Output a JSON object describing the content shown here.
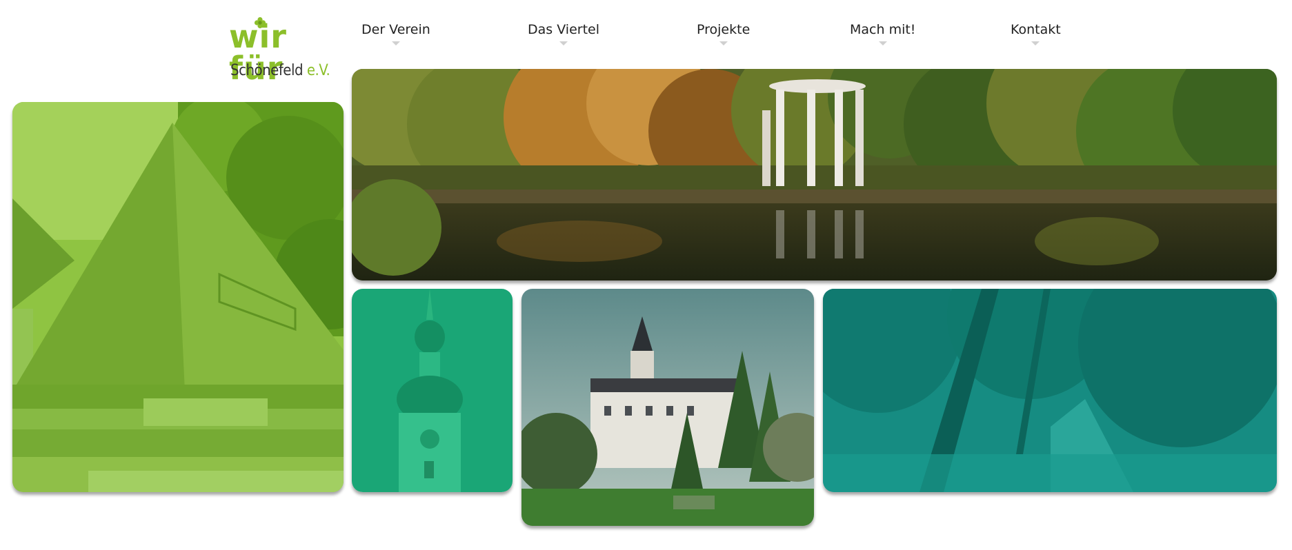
{
  "logo": {
    "line1": "wir für",
    "line2": "Schönefeld",
    "suffix": "e.V.",
    "colors": {
      "green": "#8cbf2a",
      "dark": "#333333"
    }
  },
  "nav": {
    "items": [
      {
        "label": "Der Verein"
      },
      {
        "label": "Das Viertel"
      },
      {
        "label": "Projekte"
      },
      {
        "label": "Mach mit!"
      },
      {
        "label": "Kontakt"
      }
    ]
  },
  "tiles": [
    {
      "subject": "pyramid-monument",
      "overlay": "#7dbb2a"
    },
    {
      "subject": "autumn-park-pond-with-temple",
      "overlay": "none"
    },
    {
      "subject": "church-tower",
      "overlay": "#17a374"
    },
    {
      "subject": "schoenefeld-castle",
      "overlay": "none"
    },
    {
      "subject": "tree-lined-path",
      "overlay": "#138f84"
    }
  ]
}
